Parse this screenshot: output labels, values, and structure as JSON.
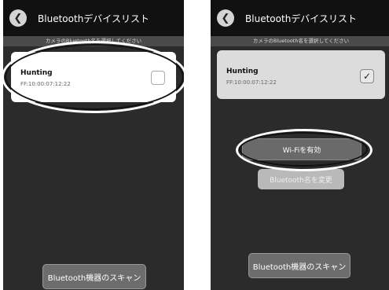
{
  "screen_left": {
    "title": "Bluetoothデバイスリスト",
    "subtitle": "カメラのBluetooth名を選択してください",
    "device": {
      "name": "Hunting",
      "mac": "FF:10:00:07:12:22",
      "checked": false
    },
    "scan_button": "Bluetooth機器のスキャン"
  },
  "screen_right": {
    "title": "Bluetoothデバイスリスト",
    "subtitle": "カメラのBluetooth名を選択してください",
    "device": {
      "name": "Hunting",
      "mac": "FF:10:00:07:12:22",
      "checked": true,
      "check_mark": "✓"
    },
    "wifi_button": "Wi-Fiを有効",
    "rename_button": "Bluetooth名を変更",
    "scan_button": "Bluetooth機器のスキャン"
  },
  "icons": {
    "back": "chevron-left-icon",
    "checkbox": "checkbox-icon"
  }
}
